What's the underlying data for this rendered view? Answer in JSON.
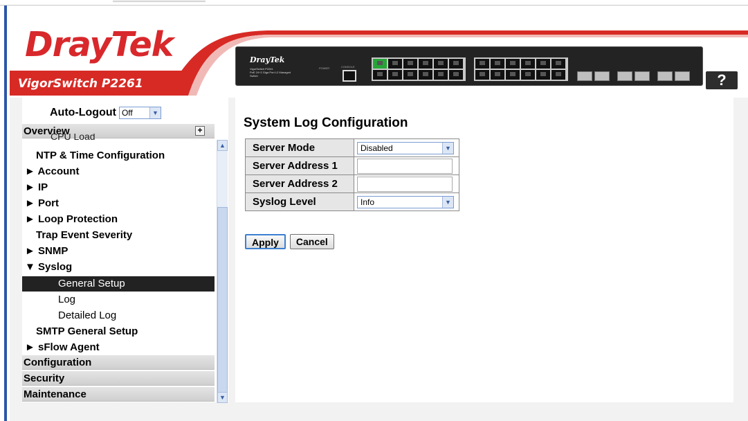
{
  "header": {
    "brand": "DrayTek",
    "model": "VigorSwitch P2261",
    "panel_brand": "DrayTek",
    "panel_model": "VigorSwitch P2261",
    "panel_sub": "PoE 24+2 Giga Port L2 Managed Switch",
    "panel_power": "POWER",
    "panel_console": "CONSOLE",
    "help_label": "?"
  },
  "sidebar": {
    "auto_logout_label": "Auto-Logout",
    "auto_logout_value": "Off",
    "overview_label": "Overview",
    "clipped_item": "CPU Load",
    "items": [
      {
        "label": "NTP & Time Configuration"
      },
      {
        "label": "► Account"
      },
      {
        "label": "► IP"
      },
      {
        "label": "► Port"
      },
      {
        "label": "► Loop Protection"
      },
      {
        "label": "Trap Event Severity"
      },
      {
        "label": "► SNMP"
      },
      {
        "label": "▼ Syslog"
      },
      {
        "label": "General Setup"
      },
      {
        "label": "Log"
      },
      {
        "label": "Detailed Log"
      },
      {
        "label": "SMTP General Setup"
      },
      {
        "label": "► sFlow Agent"
      }
    ],
    "sections": [
      "Configuration",
      "Security",
      "Maintenance"
    ]
  },
  "main": {
    "title": "System Log Configuration",
    "rows": [
      {
        "label": "Server Mode",
        "type": "select",
        "value": "Disabled"
      },
      {
        "label": "Server Address 1",
        "type": "text",
        "value": ""
      },
      {
        "label": "Server Address 2",
        "type": "text",
        "value": ""
      },
      {
        "label": "Syslog Level",
        "type": "select",
        "value": "Info"
      }
    ],
    "apply_label": "Apply",
    "cancel_label": "Cancel"
  },
  "colors": {
    "brand_red": "#d72a25",
    "active_menu_bg": "#222222",
    "section_bar": "#d8d8d8"
  }
}
